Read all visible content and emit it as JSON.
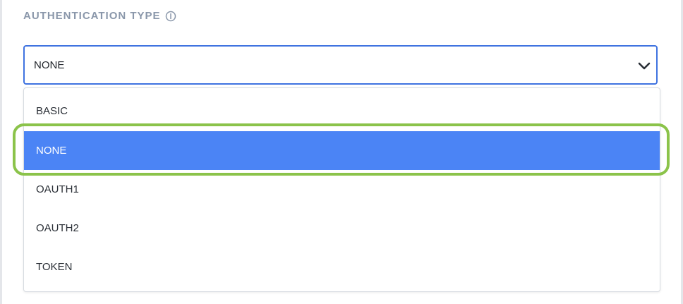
{
  "field": {
    "label": "AUTHENTICATION TYPE",
    "info_icon": "info-circle-icon",
    "selected_value": "NONE",
    "chevron_icon": "chevron-down-icon"
  },
  "dropdown": {
    "options": [
      {
        "label": "BASIC",
        "selected": false
      },
      {
        "label": "NONE",
        "selected": true
      },
      {
        "label": "OAUTH1",
        "selected": false
      },
      {
        "label": "OAUTH2",
        "selected": false
      },
      {
        "label": "TOKEN",
        "selected": false
      }
    ]
  },
  "colors": {
    "accent": "#3f73e0",
    "selected_option_bg": "#4b84f5",
    "highlight_ring": "#8bc34a",
    "label_text": "#8a97aa"
  }
}
